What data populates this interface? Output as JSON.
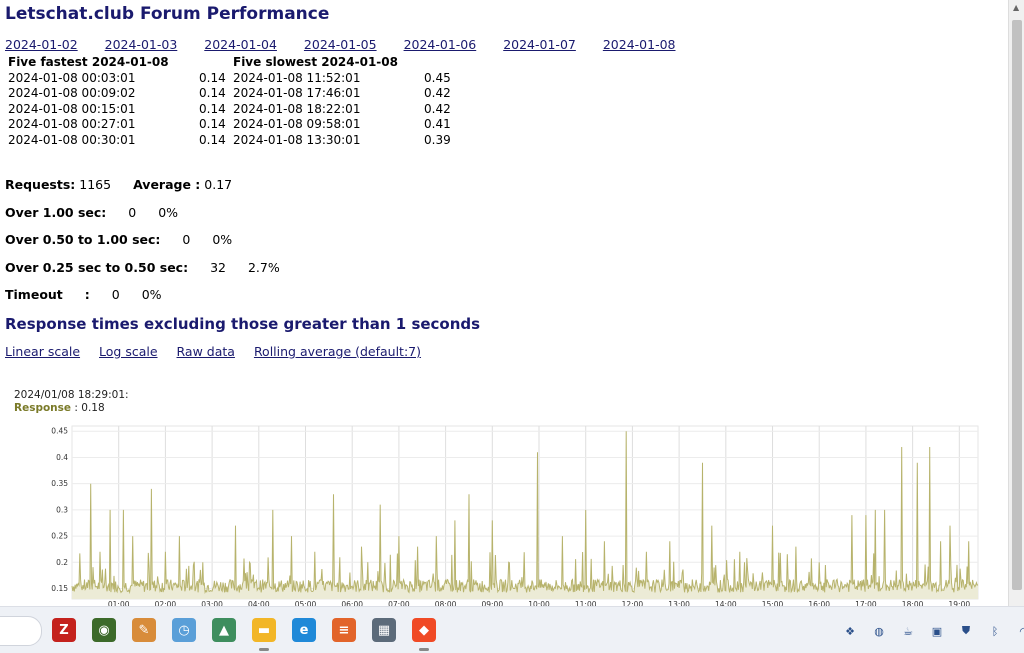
{
  "page": {
    "title": "Letschat.club Forum Performance",
    "date_links": [
      "2024-01-02",
      "2024-01-03",
      "2024-01-04",
      "2024-01-05",
      "2024-01-06",
      "2024-01-07",
      "2024-01-08"
    ],
    "fastest_header": "Five fastest 2024-01-08",
    "slowest_header": "Five slowest 2024-01-08",
    "rows": [
      {
        "fast_time": "2024-01-08 00:03:01",
        "fast_val": "0.14",
        "slow_time": "2024-01-08 11:52:01",
        "slow_val": "0.45"
      },
      {
        "fast_time": "2024-01-08 00:09:02",
        "fast_val": "0.14",
        "slow_time": "2024-01-08 17:46:01",
        "slow_val": "0.42"
      },
      {
        "fast_time": "2024-01-08 00:15:01",
        "fast_val": "0.14",
        "slow_time": "2024-01-08 18:22:01",
        "slow_val": "0.42"
      },
      {
        "fast_time": "2024-01-08 00:27:01",
        "fast_val": "0.14",
        "slow_time": "2024-01-08 09:58:01",
        "slow_val": "0.41"
      },
      {
        "fast_time": "2024-01-08 00:30:01",
        "fast_val": "0.14",
        "slow_time": "2024-01-08 13:30:01",
        "slow_val": "0.39"
      }
    ],
    "stats": {
      "requests_label": "Requests:",
      "requests_value": "1165",
      "average_label": "Average :",
      "average_value": "0.17",
      "over1_label": "Over 1.00 sec:",
      "over1_count": "0",
      "over1_pct": "0%",
      "over050_label": "Over 0.50 to 1.00 sec:",
      "over050_count": "0",
      "over050_pct": "0%",
      "over025_label": "Over 0.25 sec to 0.50 sec:",
      "over025_count": "32",
      "over025_pct": "2.7%",
      "timeout_label": "Timeout",
      "timeout_colon": ":",
      "timeout_count": "0",
      "timeout_pct": "0%"
    },
    "subtitle": "Response times excluding those greater than 1 seconds",
    "scale_links": [
      "Linear scale",
      "Log scale",
      "Raw data",
      "Rolling average (default:7)"
    ],
    "tooltip": {
      "time": "2024/01/08 18:29:01:",
      "label": "Response",
      "sep": " : ",
      "value": "0.18"
    }
  },
  "chart_data": {
    "type": "area",
    "x_ticks": [
      "01:00",
      "02:00",
      "03:00",
      "04:00",
      "05:00",
      "06:00",
      "07:00",
      "08:00",
      "09:00",
      "10:00",
      "11:00",
      "12:00",
      "13:00",
      "14:00",
      "15:00",
      "16:00",
      "17:00",
      "18:00",
      "19:00"
    ],
    "y_ticks": [
      "0.15",
      "0.2",
      "0.25",
      "0.3",
      "0.35",
      "0.4",
      "0.45"
    ],
    "ylim": [
      0.13,
      0.46
    ],
    "xlim_hours": [
      0,
      19.4
    ],
    "grid": true,
    "series_color": "#b7b36c",
    "fill_color": "#ecebd6",
    "baseline": 0.155,
    "spikes": [
      {
        "h": 0.4,
        "v": 0.35
      },
      {
        "h": 0.6,
        "v": 0.22
      },
      {
        "h": 0.82,
        "v": 0.3
      },
      {
        "h": 1.1,
        "v": 0.3
      },
      {
        "h": 1.3,
        "v": 0.25
      },
      {
        "h": 1.7,
        "v": 0.34
      },
      {
        "h": 2.0,
        "v": 0.22
      },
      {
        "h": 2.3,
        "v": 0.25
      },
      {
        "h": 2.8,
        "v": 0.2
      },
      {
        "h": 3.5,
        "v": 0.27
      },
      {
        "h": 3.8,
        "v": 0.2
      },
      {
        "h": 4.3,
        "v": 0.3
      },
      {
        "h": 4.7,
        "v": 0.25
      },
      {
        "h": 5.2,
        "v": 0.22
      },
      {
        "h": 5.6,
        "v": 0.33
      },
      {
        "h": 6.2,
        "v": 0.23
      },
      {
        "h": 6.6,
        "v": 0.31
      },
      {
        "h": 7.0,
        "v": 0.25
      },
      {
        "h": 7.4,
        "v": 0.23
      },
      {
        "h": 7.8,
        "v": 0.25
      },
      {
        "h": 8.2,
        "v": 0.28
      },
      {
        "h": 8.5,
        "v": 0.33
      },
      {
        "h": 9.0,
        "v": 0.28
      },
      {
        "h": 9.35,
        "v": 0.2
      },
      {
        "h": 9.97,
        "v": 0.41
      },
      {
        "h": 10.5,
        "v": 0.25
      },
      {
        "h": 11.0,
        "v": 0.3
      },
      {
        "h": 11.4,
        "v": 0.24
      },
      {
        "h": 11.87,
        "v": 0.45
      },
      {
        "h": 12.3,
        "v": 0.22
      },
      {
        "h": 12.8,
        "v": 0.24
      },
      {
        "h": 13.5,
        "v": 0.39
      },
      {
        "h": 13.7,
        "v": 0.27
      },
      {
        "h": 14.3,
        "v": 0.22
      },
      {
        "h": 15.0,
        "v": 0.27
      },
      {
        "h": 15.5,
        "v": 0.23
      },
      {
        "h": 16.0,
        "v": 0.2
      },
      {
        "h": 16.7,
        "v": 0.29
      },
      {
        "h": 17.0,
        "v": 0.29
      },
      {
        "h": 17.2,
        "v": 0.3
      },
      {
        "h": 17.4,
        "v": 0.3
      },
      {
        "h": 17.77,
        "v": 0.42
      },
      {
        "h": 18.1,
        "v": 0.39
      },
      {
        "h": 18.37,
        "v": 0.42
      },
      {
        "h": 18.6,
        "v": 0.24
      },
      {
        "h": 18.8,
        "v": 0.27
      },
      {
        "h": 19.2,
        "v": 0.24
      }
    ]
  },
  "taskbar": {
    "apps": [
      {
        "name": "filezilla-icon",
        "glyph": "Z",
        "color": "#c4221d",
        "active": false
      },
      {
        "name": "globe-icon",
        "glyph": "◉",
        "color": "#3c6a2a",
        "active": false
      },
      {
        "name": "paint-icon",
        "glyph": "✎",
        "color": "#d88c3a",
        "active": false
      },
      {
        "name": "clock-icon",
        "glyph": "◷",
        "color": "#5a9fd8",
        "active": false
      },
      {
        "name": "triangle-app-icon",
        "glyph": "▲",
        "color": "#3e8e5e",
        "active": false
      },
      {
        "name": "file-explorer-icon",
        "glyph": "▬",
        "color": "#f2b627",
        "active": true
      },
      {
        "name": "edge-icon",
        "glyph": "e",
        "color": "#1f89d8",
        "active": false
      },
      {
        "name": "stack-app-icon",
        "glyph": "≡",
        "color": "#e2642a",
        "active": false
      },
      {
        "name": "calculator-icon",
        "glyph": "▦",
        "color": "#5c6b7a",
        "active": false
      },
      {
        "name": "brave-icon",
        "glyph": "◆",
        "color": "#f04a25",
        "active": true
      }
    ],
    "tray": [
      {
        "name": "dropbox-icon",
        "glyph": "❖"
      },
      {
        "name": "network-globe-icon",
        "glyph": "◍"
      },
      {
        "name": "cup-icon",
        "glyph": "☕"
      },
      {
        "name": "monitor-app-icon",
        "glyph": "▣"
      },
      {
        "name": "shield-icon",
        "glyph": "⛊"
      },
      {
        "name": "bluetooth-icon",
        "glyph": "ᛒ"
      },
      {
        "name": "wifi-icon",
        "glyph": "◠"
      }
    ]
  }
}
